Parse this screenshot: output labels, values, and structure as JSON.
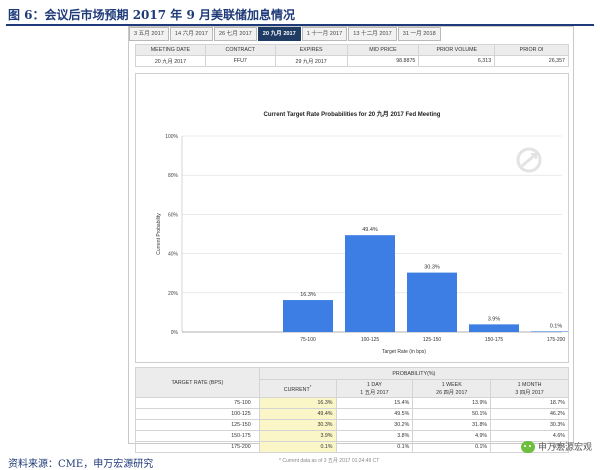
{
  "figure": {
    "title": "图 6：会议后市场预期 2017 年 9 月美联储加息情况",
    "source": "资料来源：CME，申万宏源研究",
    "brand": "申万宏源宏观"
  },
  "tabs": [
    {
      "label": "3 五月 2017",
      "active": false
    },
    {
      "label": "14 六月 2017",
      "active": false
    },
    {
      "label": "26 七月 2017",
      "active": false
    },
    {
      "label": "20 九月 2017",
      "active": true
    },
    {
      "label": "1 十一月 2017",
      "active": false
    },
    {
      "label": "13 十二月 2017",
      "active": false
    },
    {
      "label": "31 一月 2018",
      "active": false
    }
  ],
  "meeting_info": {
    "headers": [
      "Meeting Date",
      "Contract",
      "Expires",
      "Mid Price",
      "Prior Volume",
      "Prior OI"
    ],
    "row": [
      "20 九月 2017",
      "FFU7",
      "29 九月 2017",
      "98.8875",
      "6,313",
      "26,357"
    ]
  },
  "chart_data": {
    "type": "bar",
    "title": "Current Target Rate Probabilities for 20 九月 2017 Fed Meeting",
    "xlabel": "Target Rate (in bps)",
    "ylabel": "Current Probability",
    "categories": [
      "75-100",
      "100-125",
      "125-150",
      "150-175",
      "175-200"
    ],
    "values": [
      16.3,
      49.4,
      30.3,
      3.9,
      0.1
    ],
    "value_labels": [
      "16.3%",
      "49.4%",
      "30.3%",
      "3.9%",
      "0.1%"
    ],
    "ylim": [
      0,
      100
    ],
    "yticks": [
      "0%",
      "20%",
      "40%",
      "60%",
      "80%",
      "100%"
    ],
    "grid": true,
    "bar_color": "#3c7ee3"
  },
  "probability_table": {
    "group_header": "PROBABILITY(%)",
    "rate_header": "TARGET RATE (BPS)",
    "columns": [
      {
        "line1": "CURRENT",
        "line2": ""
      },
      {
        "line1": "1 DAY",
        "line2": "1 五月 2017"
      },
      {
        "line1": "1 WEEK",
        "line2": "26 四月 2017"
      },
      {
        "line1": "1 MONTH",
        "line2": "3 四月 2017"
      }
    ],
    "rows": [
      {
        "rate": "75-100",
        "current": "16.3%",
        "day": "15.4%",
        "week": "13.9%",
        "month": "18.7%"
      },
      {
        "rate": "100-125",
        "current": "49.4%",
        "day": "49.5%",
        "week": "50.1%",
        "month": "46.2%"
      },
      {
        "rate": "125-150",
        "current": "30.3%",
        "day": "30.2%",
        "week": "31.8%",
        "month": "30.3%"
      },
      {
        "rate": "150-175",
        "current": "3.9%",
        "day": "3.8%",
        "week": "4.9%",
        "month": "4.6%"
      },
      {
        "rate": "175-200",
        "current": "0.1%",
        "day": "0.1%",
        "week": "0.1%",
        "month": "0.1%"
      }
    ],
    "footnote": "* Current data as of 3 五月 2017 01:24:49 CT"
  }
}
